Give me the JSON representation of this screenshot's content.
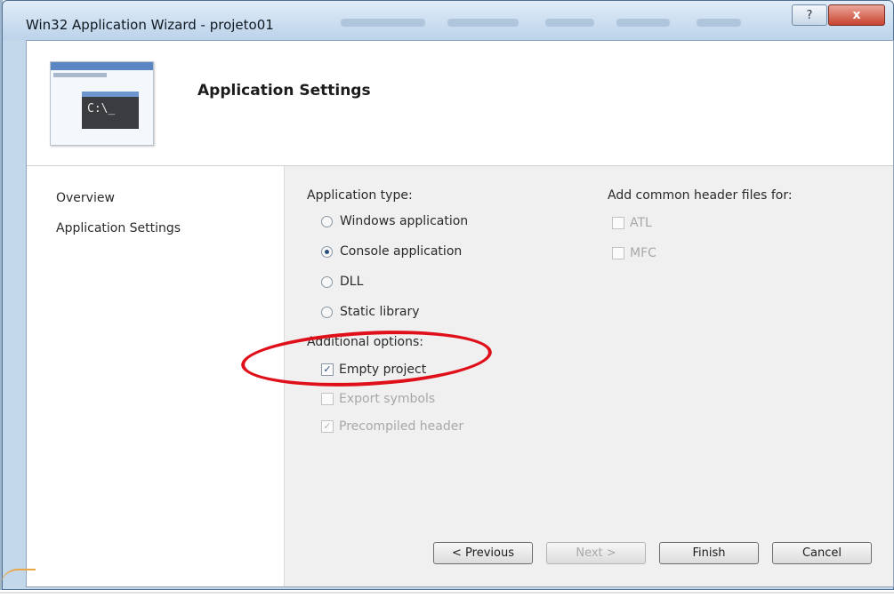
{
  "window": {
    "title": "Win32 Application Wizard - projeto01",
    "help_label": "?",
    "close_label": "x"
  },
  "header": {
    "title": "Application Settings",
    "console_text": "C:\\_"
  },
  "nav": {
    "items": [
      {
        "label": "Overview"
      },
      {
        "label": "Application Settings"
      }
    ]
  },
  "app_type": {
    "label": "Application type:",
    "options": [
      {
        "label": "Windows application",
        "selected": false
      },
      {
        "label": "Console application",
        "selected": true
      },
      {
        "label": "DLL",
        "selected": false
      },
      {
        "label": "Static library",
        "selected": false
      }
    ]
  },
  "additional": {
    "label": "Additional options:",
    "options": [
      {
        "label": "Empty project",
        "checked": true,
        "enabled": true
      },
      {
        "label": "Export symbols",
        "checked": false,
        "enabled": false
      },
      {
        "label": "Precompiled header",
        "checked": true,
        "enabled": false
      }
    ]
  },
  "headers": {
    "label": "Add common header files for:",
    "options": [
      {
        "label": "ATL",
        "checked": false,
        "enabled": false
      },
      {
        "label": "MFC",
        "checked": false,
        "enabled": false
      }
    ]
  },
  "buttons": {
    "previous": "< Previous",
    "next": "Next >",
    "finish": "Finish",
    "cancel": "Cancel"
  },
  "colors": {
    "annotation_oval": "#e0101a",
    "close_button": "#c84330"
  }
}
